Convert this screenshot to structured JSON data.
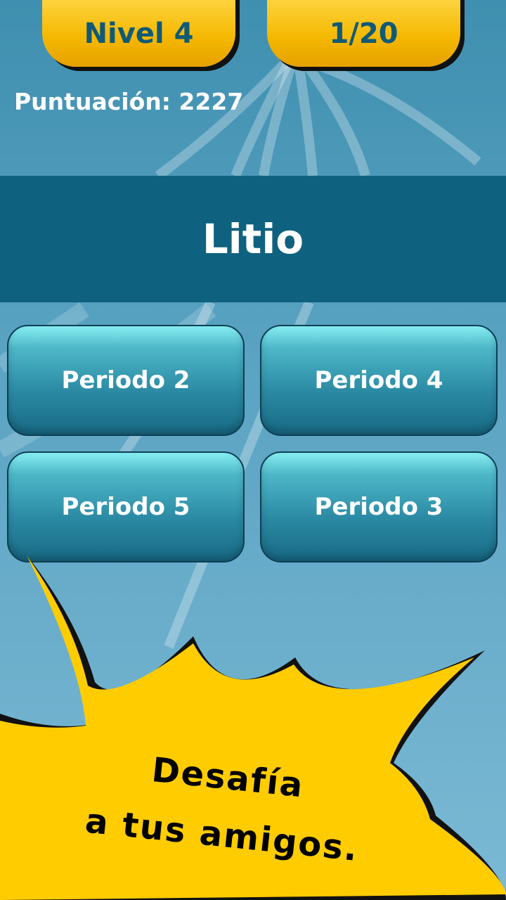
{
  "header": {
    "level_label": "Nivel 4",
    "progress_label": "1/20",
    "score_label": "Puntuación: 2227"
  },
  "question": {
    "text": "Litio"
  },
  "answers": [
    {
      "label": "Periodo 2"
    },
    {
      "label": "Periodo 4"
    },
    {
      "label": "Periodo 5"
    },
    {
      "label": "Periodo 3"
    }
  ],
  "promo": {
    "line1": "Desafía",
    "line2": "a tus amigos."
  },
  "colors": {
    "accent_yellow": "#f5b800",
    "question_band": "#0f627f",
    "pill_text": "#0f5a78",
    "promo_yellow": "#ffcc00"
  }
}
